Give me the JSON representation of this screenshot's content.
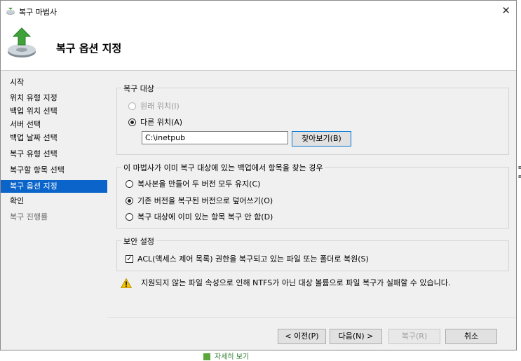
{
  "window": {
    "title": "복구 마법사",
    "close_glyph": "✕"
  },
  "header": {
    "title": "복구 옵션 지정"
  },
  "nav": {
    "items": [
      {
        "label": "시작",
        "state": "normal"
      },
      {
        "label": "위치 유형 지정",
        "state": "normal"
      },
      {
        "label": "백업 위치 선택",
        "state": "normal"
      },
      {
        "label": "서버 선택",
        "state": "normal"
      },
      {
        "label": "백업 날짜 선택",
        "state": "normal"
      },
      {
        "label": "복구 유형 선택",
        "state": "normal"
      },
      {
        "label": "복구할 항목 선택",
        "state": "normal"
      },
      {
        "label": "복구 옵션 지정",
        "state": "selected"
      },
      {
        "label": "확인",
        "state": "normal"
      },
      {
        "label": "복구 진행률",
        "state": "disabled"
      }
    ]
  },
  "recovery_target": {
    "legend": "복구 대상",
    "original_location": {
      "label": "원래 위치(I)",
      "selected": false,
      "enabled": false
    },
    "other_location": {
      "label": "다른 위치(A)",
      "selected": true,
      "enabled": true
    },
    "path_value": "C:\\inetpub",
    "browse_label": "찾아보기(B)"
  },
  "conflict": {
    "legend": "이 마법사가 이미 복구 대상에 있는 백업에서 항목을 찾는 경우",
    "options": [
      {
        "label": "복사본을 만들어 두 버전 모두 유지(C)",
        "selected": false
      },
      {
        "label": "기존 버전을 복구된 버전으로 덮어쓰기(O)",
        "selected": true
      },
      {
        "label": "복구 대상에 이미 있는 항목 복구 안 함(D)",
        "selected": false
      }
    ]
  },
  "security": {
    "legend": "보안 설정",
    "acl_label": "ACL(액세스 제어 목록) 권한을 복구되고 있는 파일 또는 폴더로 복원(S)",
    "acl_checked": true
  },
  "warning": {
    "icon": "warning-icon",
    "text": "지원되지 않는 파일 속성으로 인해 NTFS가 아닌 대상 볼륨으로 파일 복구가 실패할 수 있습니다."
  },
  "buttons": {
    "back": "< 이전(P)",
    "next": "다음(N) >",
    "recover": "복구(R)",
    "cancel": "취소"
  },
  "background": {
    "peek_text": "자세히 보기"
  },
  "colors": {
    "selection": "#0a64c9",
    "panel": "#f0f0f0",
    "warning": "#f2c200"
  }
}
